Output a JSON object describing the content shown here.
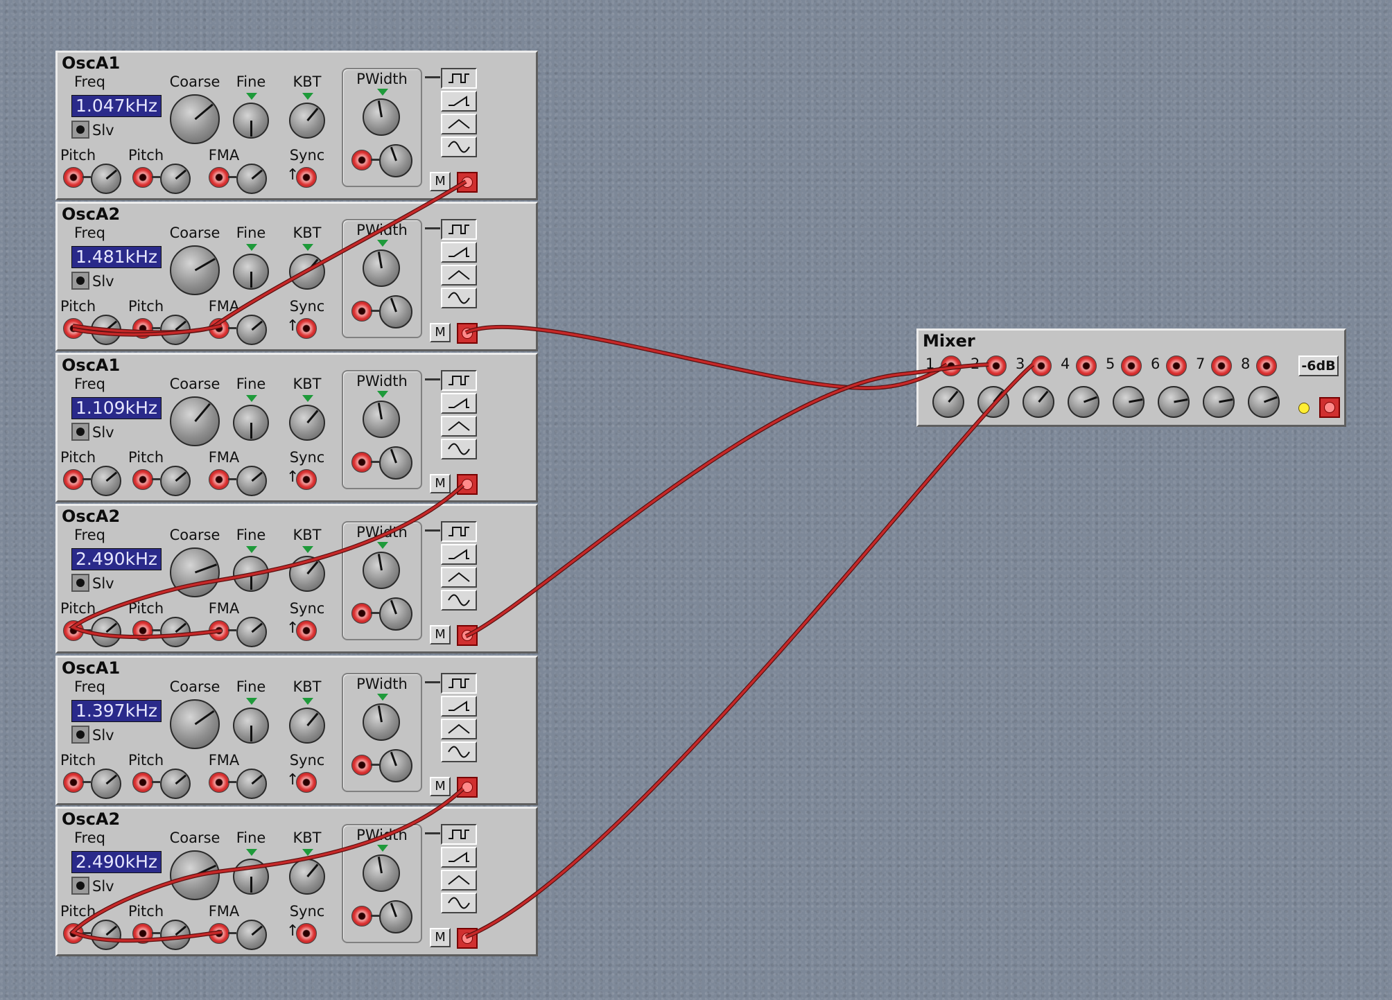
{
  "modules": [
    {
      "title": "OscA1",
      "freq": "1.047kHz"
    },
    {
      "title": "OscA2",
      "freq": "1.481kHz"
    },
    {
      "title": "OscA1",
      "freq": "1.109kHz"
    },
    {
      "title": "OscA2",
      "freq": "2.490kHz"
    },
    {
      "title": "OscA1",
      "freq": "1.397kHz"
    },
    {
      "title": "OscA2",
      "freq": "2.490kHz"
    }
  ],
  "osc_labels": {
    "freq": "Freq",
    "coarse": "Coarse",
    "fine": "Fine",
    "kbt": "KBT",
    "pwidth": "PWidth",
    "slv": "Slv",
    "pitch": "Pitch",
    "fma": "FMA",
    "sync": "Sync",
    "m": "M",
    "sync_arrow": "↑"
  },
  "mixer": {
    "title": "Mixer",
    "inputs": [
      "1",
      "2",
      "3",
      "4",
      "5",
      "6",
      "7",
      "8"
    ],
    "db_button": "-6dB"
  },
  "icons": {
    "wave_buttons": [
      "square-wave-icon",
      "saw-wave-icon",
      "triangle-wave-icon",
      "sine-wave-icon"
    ]
  },
  "colors": {
    "background": "#7d8898",
    "panel": "#c4c4c4",
    "cable": "#c62828",
    "freq_display": "#2a2a8a",
    "indicator": "#1e9a3a"
  }
}
